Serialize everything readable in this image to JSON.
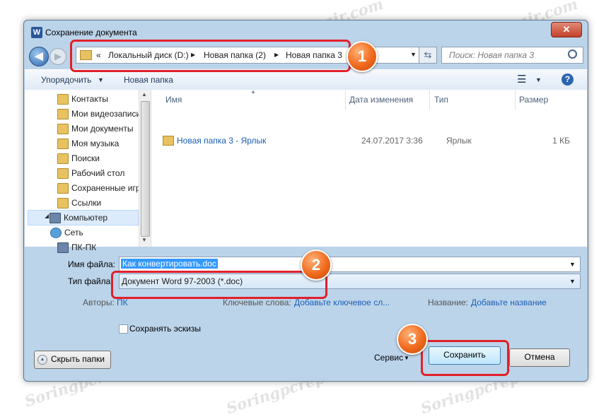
{
  "window": {
    "title": "Сохранение документа",
    "app_icon": "W",
    "close_glyph": "✕"
  },
  "nav": {
    "crumbs_prefix": "«",
    "breadcrumbs": [
      "Локальный диск (D:)",
      "Новая папка (2)",
      "Новая папка 3"
    ],
    "search_placeholder": "Поиск: Новая папка 3"
  },
  "toolbar": {
    "organize": "Упорядочить",
    "new_folder": "Новая папка"
  },
  "sidebar": {
    "items": [
      "Контакты",
      "Мои видеозаписи",
      "Мои документы",
      "Моя музыка",
      "Поиски",
      "Рабочий стол",
      "Сохраненные игры",
      "Ссылки",
      "Компьютер",
      "Сеть",
      "ПК-ПК"
    ]
  },
  "list": {
    "columns": [
      "Имя",
      "Дата изменения",
      "Тип",
      "Размер"
    ],
    "rows": [
      {
        "name": "Новая папка 3 - Ярлык",
        "date": "24.07.2017 3:36",
        "type": "Ярлык",
        "size": "1 КБ"
      }
    ]
  },
  "form": {
    "filename_label": "Имя файла:",
    "filename_value": "Как конвертировать.doc",
    "filetype_label": "Тип файла:",
    "filetype_value": "Документ Word 97-2003 (*.doc)",
    "authors_label": "Авторы:",
    "authors_value": "ПК",
    "keywords_label": "Ключевые слова:",
    "keywords_value": "Добавьте ключевое сл...",
    "title_label": "Название:",
    "title_value": "Добавьте название",
    "thumbnails_label": "Сохранять эскизы"
  },
  "footer": {
    "hide_folders": "Скрыть папки",
    "tools": "Сервис",
    "save": "Сохранить",
    "cancel": "Отмена"
  },
  "badges": [
    "1",
    "2",
    "3"
  ],
  "watermark": "Soringpcrepair.com",
  "colors": {
    "highlight": "#e2202a",
    "badge": "#f06a1c",
    "link": "#1a5fb4",
    "selection": "#3399ff"
  }
}
